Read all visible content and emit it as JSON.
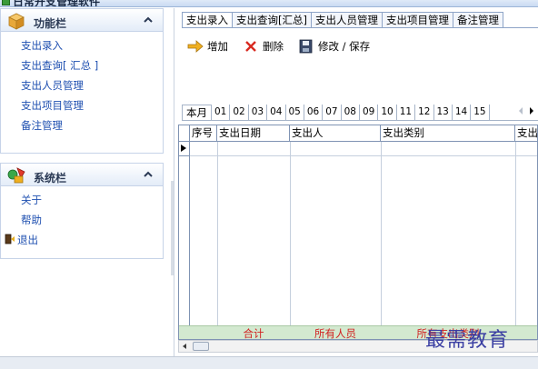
{
  "window": {
    "title": "日常开支管理软件"
  },
  "sidebar": {
    "groups": [
      {
        "title": "功能栏",
        "items": [
          {
            "label": "支出录入"
          },
          {
            "label": "支出查询[ 汇总 ]"
          },
          {
            "label": "支出人员管理"
          },
          {
            "label": "支出项目管理"
          },
          {
            "label": "备注管理"
          }
        ]
      },
      {
        "title": "系统栏",
        "items": [
          {
            "label": "关于"
          },
          {
            "label": "帮助"
          },
          {
            "label": "退出"
          }
        ]
      }
    ]
  },
  "tabs": [
    {
      "label": "支出录入",
      "active": true
    },
    {
      "label": "支出查询[汇总]"
    },
    {
      "label": "支出人员管理"
    },
    {
      "label": "支出项目管理"
    },
    {
      "label": "备注管理"
    }
  ],
  "toolbar": {
    "add_label": "增加",
    "delete_label": "删除",
    "save_label": "修改 / 保存"
  },
  "months": {
    "current_label": "本月",
    "items": [
      "01",
      "02",
      "03",
      "04",
      "05",
      "06",
      "07",
      "08",
      "09",
      "10",
      "11",
      "12",
      "13",
      "14",
      "15"
    ]
  },
  "grid": {
    "columns": [
      "序号",
      "支出日期",
      "支出人",
      "支出类别",
      "支出"
    ],
    "summary": {
      "total_label": "合计",
      "all_people_label": "所有人员",
      "all_categories_label": "所有支出类别"
    }
  },
  "watermark": "最需教育",
  "colors": {
    "link": "#1e4fb0",
    "summary_bg": "#d3e9d0",
    "summary_text": "#d22020",
    "header_border": "#8ea4c7"
  }
}
